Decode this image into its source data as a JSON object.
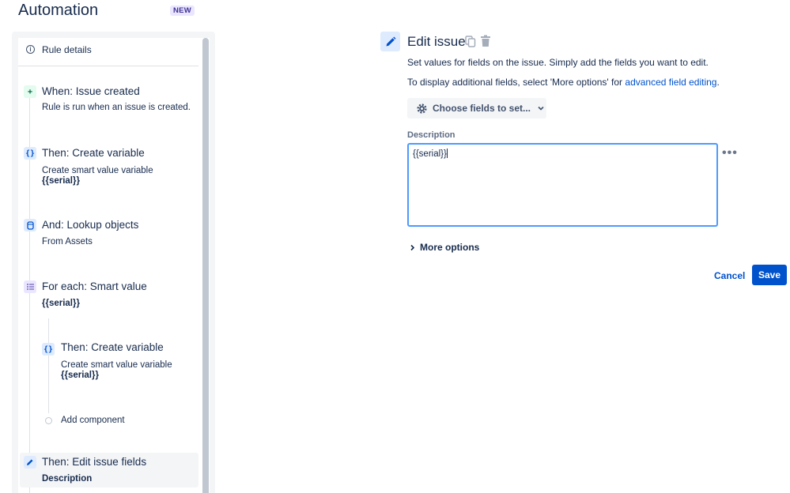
{
  "header": {
    "title": "Automation",
    "badge": "NEW"
  },
  "sidebar": {
    "rule_details_label": "Rule details",
    "steps": [
      {
        "icon": "plus-icon",
        "title": "When: Issue created",
        "subtitle": "Rule is run when an issue is created.",
        "value": ""
      },
      {
        "icon": "braces-icon",
        "title": "Then: Create variable",
        "subtitle": "Create smart value variable",
        "value": "{{serial}}"
      },
      {
        "icon": "database-icon",
        "title": "And: Lookup objects",
        "subtitle": "From Assets",
        "value": ""
      },
      {
        "icon": "list-icon",
        "title": "For each: Smart value",
        "subtitle": "",
        "value": "{{serial}}"
      },
      {
        "icon": "braces-icon",
        "title": "Then: Create variable",
        "subtitle": "Create smart value variable",
        "value": "{{serial}}"
      },
      {
        "icon": "pencil-icon",
        "title": "Then: Edit issue fields",
        "subtitle": "",
        "value": "Description"
      }
    ],
    "add_component_label": "Add component"
  },
  "panel": {
    "title": "Edit issue",
    "description": "Set values for fields on the issue. Simply add the fields you want to edit.",
    "additional_prefix": "To display additional fields, select 'More options' for ",
    "additional_link": "advanced field editing",
    "additional_suffix": ".",
    "choose_fields_label": "Choose fields to set...",
    "field_label": "Description",
    "field_value": "{{serial}}",
    "more_options_label": "More options",
    "cancel_label": "Cancel",
    "save_label": "Save"
  },
  "colors": {
    "primary": "#0052cc",
    "text": "#172b4d",
    "focus_border": "#4c9aff",
    "trigger_icon_bg": "#e3fcef",
    "action_icon_bg": "#deebff",
    "branch_icon_bg": "#eae6ff"
  }
}
